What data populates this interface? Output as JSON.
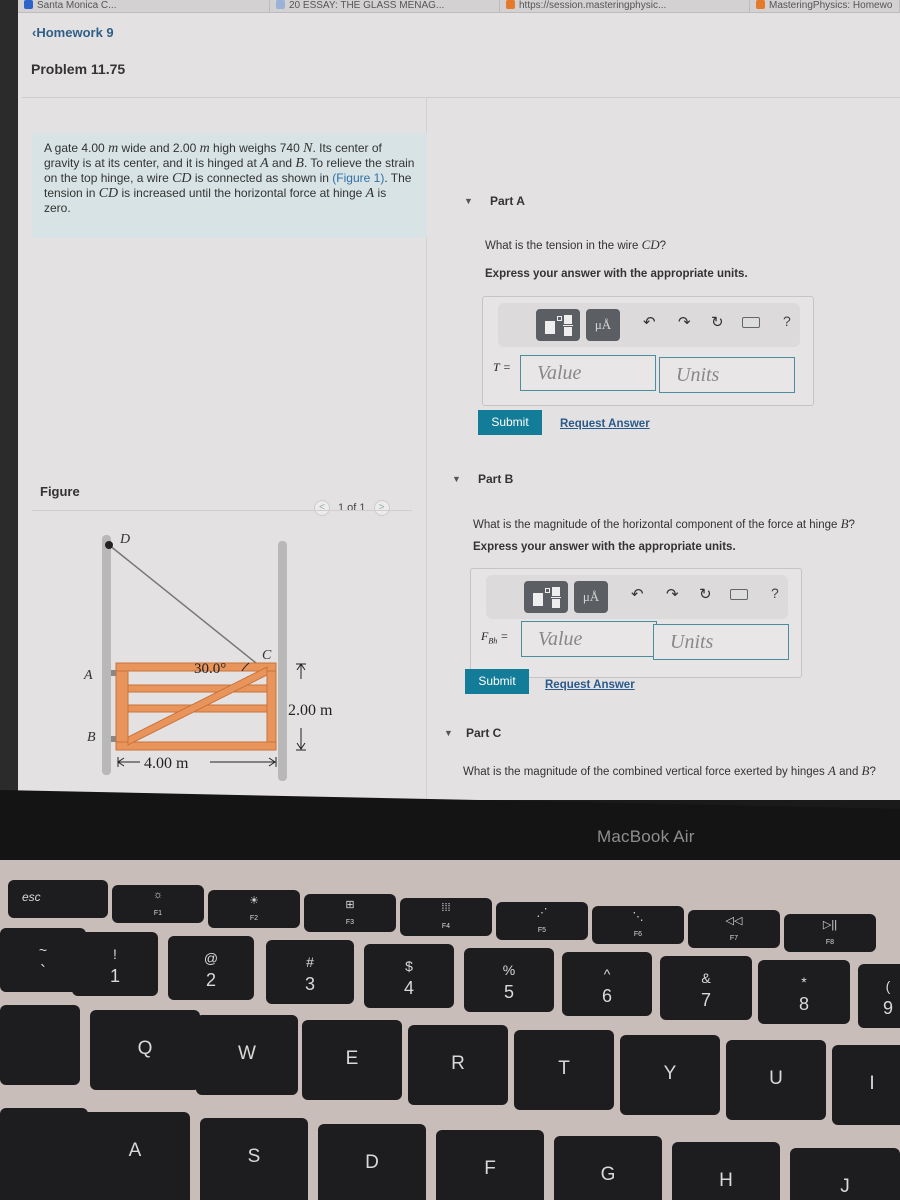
{
  "browser": {
    "tabs": [
      {
        "label": "Santa Monica C...",
        "icon": "canvas-icon"
      },
      {
        "label": "20 ESSAY: THE GLASS MENAG...",
        "icon": "doc-icon"
      },
      {
        "label": "https://session.masteringphysic...",
        "icon": "mastering-icon"
      },
      {
        "label": "MasteringPhysics: Homewo",
        "icon": "mastering-icon"
      }
    ]
  },
  "header": {
    "back_link": "Homework 9",
    "problem_title": "Problem 11.75"
  },
  "problem": {
    "text_parts": {
      "p1": "A gate 4.00 ",
      "m1": "m",
      "p2": " wide and 2.00 ",
      "m2": "m",
      "p3": " high weighs 740 ",
      "N": "N",
      "p4": ". Its center of gravity is at its center, and it is hinged at ",
      "A": "A",
      "p5": " and ",
      "B": "B",
      "p6": ". To relieve the strain on the top hinge, a wire ",
      "CD1": "CD",
      "p7": " is connected as shown in ",
      "figure_link": "(Figure 1)",
      "p8": ". The tension in ",
      "CD2": "CD",
      "p9": " is increased until the horizontal force at hinge ",
      "A2": "A",
      "p10": " is zero."
    }
  },
  "figure": {
    "label": "Figure",
    "pager": "1 of 1",
    "prev": "<",
    "next": ">",
    "labels": {
      "D": "D",
      "C": "C",
      "A": "A",
      "B": "B",
      "angle": "30.0°",
      "height": "2.00 m",
      "width": "4.00 m"
    },
    "colors": {
      "gate": "#e8945a",
      "gate_dark": "#c9733a",
      "post": "#b9b9b9",
      "wire": "#777777"
    }
  },
  "parts": [
    {
      "title": "Part A",
      "question_pre": "What is the tension in the wire ",
      "question_var": "CD",
      "question_post": "?",
      "instruction": "Express your answer with the appropriate units.",
      "variable": "T",
      "variable_sub": "",
      "value_placeholder": "Value",
      "units_placeholder": "Units",
      "submit": "Submit",
      "request": "Request Answer"
    },
    {
      "title": "Part B",
      "question_pre": "What is the magnitude of the horizontal component of the force at hinge ",
      "question_var": "B",
      "question_post": "?",
      "instruction": "Express your answer with the appropriate units.",
      "variable": "F",
      "variable_sub": "Bh",
      "value_placeholder": "Value",
      "units_placeholder": "Units",
      "submit": "Submit",
      "request": "Request Answer"
    },
    {
      "title": "Part C",
      "question_pre": "What is the magnitude of the combined vertical force exerted by hinges ",
      "question_var": "A",
      "question_mid": " and ",
      "question_var2": "B",
      "question_post": "?"
    }
  ],
  "toolbar": {
    "units_label": "μÅ",
    "undo": "↶",
    "redo": "↷",
    "reset": "↻",
    "help": "?"
  },
  "device": {
    "label": "MacBook Air",
    "fkeys": [
      {
        "glyph": "",
        "fn": "esc"
      },
      {
        "glyph": "☼",
        "fn": "F1"
      },
      {
        "glyph": "☀",
        "fn": "F2"
      },
      {
        "glyph": "⊞",
        "fn": "F3"
      },
      {
        "glyph": "⁞⁞⁞",
        "fn": "F4"
      },
      {
        "glyph": "⋰",
        "fn": "F5"
      },
      {
        "glyph": "⋱",
        "fn": "F6"
      },
      {
        "glyph": "◁◁",
        "fn": "F7"
      },
      {
        "glyph": "▷||",
        "fn": "F8"
      }
    ],
    "number_keys": [
      {
        "sym": "~",
        "num": "`"
      },
      {
        "sym": "!",
        "num": "1"
      },
      {
        "sym": "@",
        "num": "2"
      },
      {
        "sym": "#",
        "num": "3"
      },
      {
        "sym": "$",
        "num": "4"
      },
      {
        "sym": "%",
        "num": "5"
      },
      {
        "sym": "^",
        "num": "6"
      },
      {
        "sym": "&",
        "num": "7"
      },
      {
        "sym": "*",
        "num": "8"
      },
      {
        "sym": "(",
        "num": "9"
      }
    ],
    "qwerty": [
      "",
      "Q",
      "W",
      "E",
      "R",
      "T",
      "Y",
      "U",
      "I"
    ],
    "asdf": [
      "",
      "A",
      "S",
      "D",
      "F",
      "G",
      "H",
      "J"
    ]
  }
}
